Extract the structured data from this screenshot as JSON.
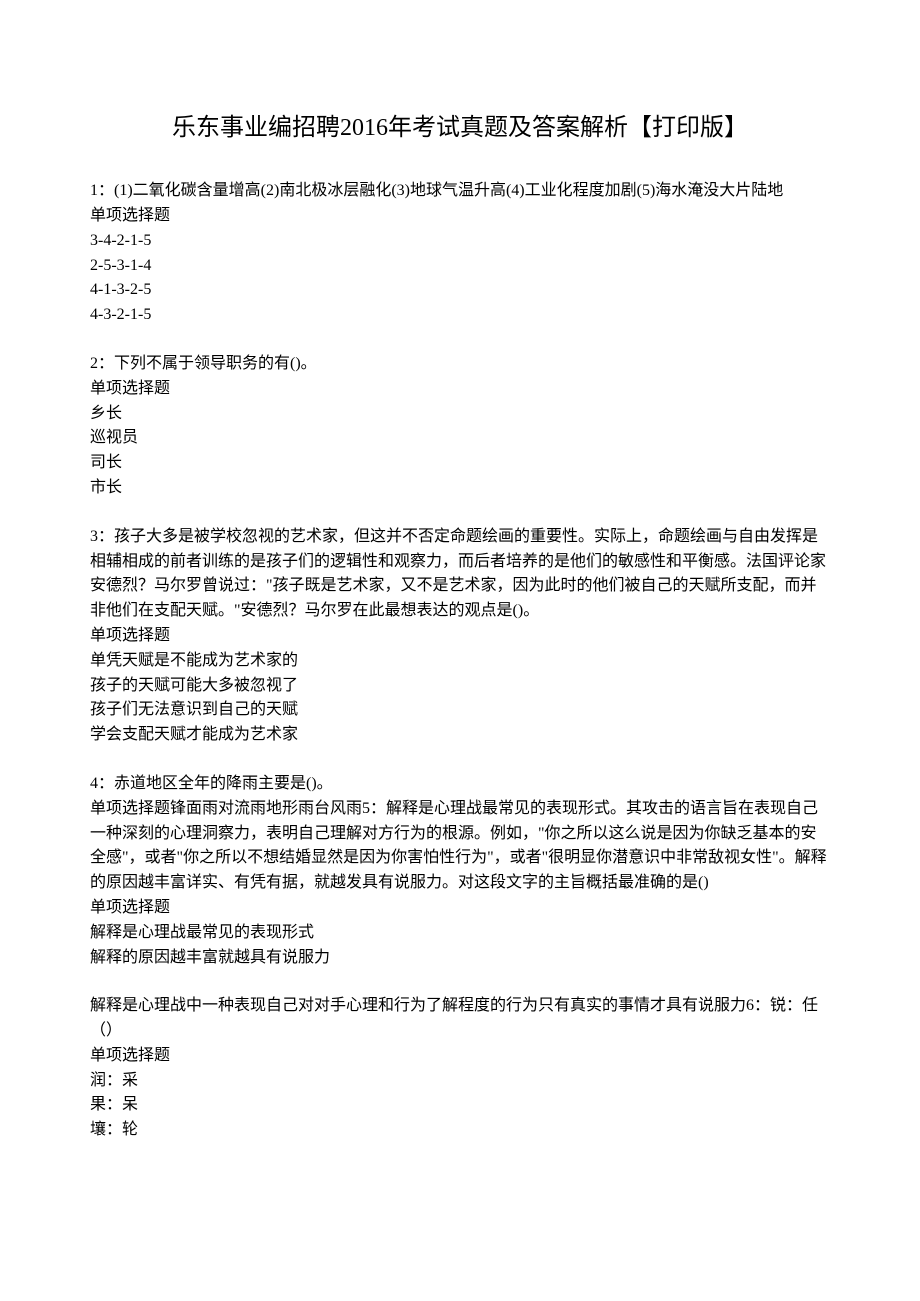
{
  "title": "乐东事业编招聘2016年考试真题及答案解析【打印版】",
  "q1": {
    "stem": "1：(1)二氧化碳含量增高(2)南北极冰层融化(3)地球气温升高(4)工业化程度加剧(5)海水淹没大片陆地",
    "type": "单项选择题",
    "opts": [
      "3-4-2-1-5",
      "2-5-3-1-4",
      "4-1-3-2-5",
      "4-3-2-1-5"
    ]
  },
  "q2": {
    "stem": "2：下列不属于领导职务的有()。",
    "type": "单项选择题",
    "opts": [
      "乡长",
      "巡视员",
      "司长",
      "市长"
    ]
  },
  "q3": {
    "stem": "3：孩子大多是被学校忽视的艺术家，但这并不否定命题绘画的重要性。实际上，命题绘画与自由发挥是相辅相成的前者训练的是孩子们的逻辑性和观察力，而后者培养的是他们的敏感性和平衡感。法国评论家安德烈？马尔罗曾说过：\"孩子既是艺术家，又不是艺术家，因为此时的他们被自己的天赋所支配，而并非他们在支配天赋。\"安德烈？马尔罗在此最想表达的观点是()。",
    "type": "单项选择题",
    "opts": [
      "单凭天赋是不能成为艺术家的",
      "孩子的天赋可能大多被忽视了",
      "孩子们无法意识到自己的天赋",
      "学会支配天赋才能成为艺术家"
    ]
  },
  "q4": {
    "stem": "4：赤道地区全年的降雨主要是()。",
    "line1": "单项选择题锋面雨对流雨地形雨台风雨5：解释是心理战最常见的表现形式。其攻击的语言旨在表现自己一种深刻的心理洞察力，表明自己理解对方行为的根源。例如，\"你之所以这么说是因为你缺乏基本的安全感\"，或者\"你之所以不想结婚显然是因为你害怕性行为\"，或者\"很明显你潜意识中非常敌视女性\"。解释的原因越丰富详实、有凭有据，就越发具有说服力。对这段文字的主旨概括最准确的是()",
    "type": "单项选择题",
    "opts": [
      "解释是心理战最常见的表现形式",
      "解释的原因越丰富就越具有说服力"
    ]
  },
  "q6": {
    "line1": "解释是心理战中一种表现自己对对手心理和行为了解程度的行为只有真实的事情才具有说服力6：锐：任（）",
    "type": "单项选择题",
    "opts": [
      "润：采",
      "果：呆",
      "壤：轮"
    ]
  }
}
